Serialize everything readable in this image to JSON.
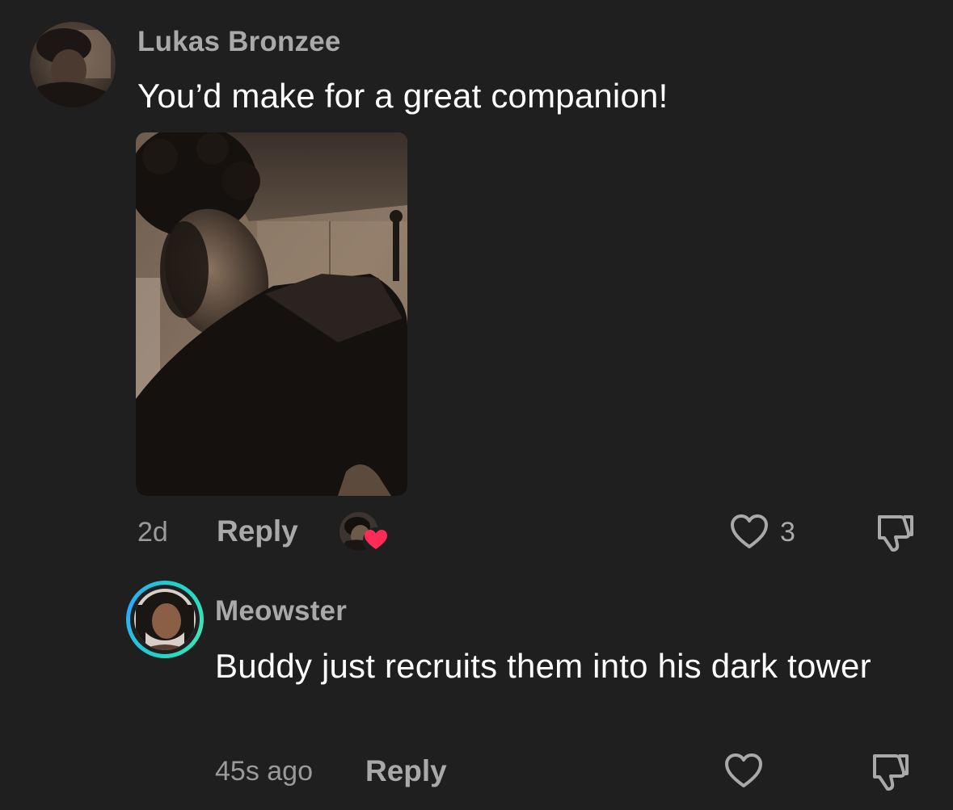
{
  "comment": {
    "username": "Lukas Bronzee",
    "text": "You’d make for a great companion!",
    "time": "2d",
    "reply_label": "Reply",
    "like_count": "3"
  },
  "reply": {
    "username": "Meowster",
    "text": "Buddy just recruits them into his dark tower",
    "time": "45s ago",
    "reply_label": "Reply"
  },
  "colors": {
    "background": "#1f1f1f",
    "secondary_text": "#a9a9a9",
    "primary_text": "#ffffff",
    "heart_accent": "#fe2c55",
    "ring_accent": "#1fd1c8"
  },
  "icons": {
    "like": "heart-outline-icon",
    "dislike": "thumbs-down-icon",
    "creator_liked": "heart-filled-icon"
  }
}
